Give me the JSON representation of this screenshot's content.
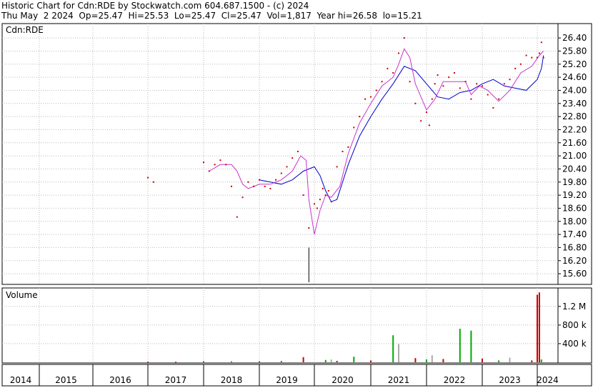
{
  "header": {
    "title_line": "Historic Chart for Cdn:RDE by Stockwatch.com 604.687.1500 - (c) 2024",
    "quote_line": "Thu May  2 2024  Op=25.47  Hi=25.53  Lo=25.47  Cl=25.47  Vol=1,817  Year hi=26.58  lo=15.21"
  },
  "chart_data": {
    "type": "line",
    "symbol_label": "Cdn:RDE",
    "volume_label": "Volume",
    "price_ticks": [
      "26.40",
      "25.80",
      "25.20",
      "24.60",
      "24.00",
      "23.40",
      "22.80",
      "22.20",
      "21.60",
      "21.00",
      "20.40",
      "19.80",
      "19.20",
      "18.60",
      "18.00",
      "17.40",
      "16.80",
      "16.20",
      "15.60"
    ],
    "volume_ticks": [
      "1.2 M",
      "800 k",
      "400 k"
    ],
    "years": [
      "2014",
      "2015",
      "2016",
      "2017",
      "2018",
      "2019",
      "2020",
      "2021",
      "2022",
      "2023",
      "2024"
    ],
    "ylim": [
      15.21,
      26.6
    ],
    "price_series": {
      "name": "close",
      "color": "#cc0000",
      "x": [
        2017.0,
        2017.1,
        2018.0,
        2018.1,
        2018.2,
        2018.3,
        2018.4,
        2018.5,
        2018.6,
        2018.7,
        2018.8,
        2018.9,
        2019.0,
        2019.1,
        2019.2,
        2019.3,
        2019.4,
        2019.5,
        2019.6,
        2019.7,
        2019.8,
        2019.9,
        2020.0,
        2020.05,
        2020.1,
        2020.15,
        2020.2,
        2020.25,
        2020.3,
        2020.4,
        2020.5,
        2020.6,
        2020.7,
        2020.8,
        2020.9,
        2021.0,
        2021.1,
        2021.2,
        2021.3,
        2021.4,
        2021.5,
        2021.6,
        2021.7,
        2021.8,
        2021.9,
        2022.0,
        2022.05,
        2022.1,
        2022.15,
        2022.2,
        2022.3,
        2022.4,
        2022.5,
        2022.6,
        2022.7,
        2022.8,
        2022.9,
        2023.0,
        2023.1,
        2023.2,
        2023.3,
        2023.4,
        2023.5,
        2023.6,
        2023.7,
        2023.8,
        2023.9,
        2024.0,
        2024.1,
        2024.2,
        2024.3
      ],
      "y": [
        20.0,
        19.8,
        20.7,
        20.3,
        20.6,
        20.8,
        20.6,
        19.6,
        18.2,
        19.1,
        19.8,
        19.6,
        19.9,
        19.6,
        19.5,
        19.9,
        20.2,
        20.5,
        20.9,
        21.2,
        19.2,
        17.7,
        18.8,
        18.6,
        19.0,
        19.5,
        19.2,
        19.4,
        18.9,
        20.5,
        21.2,
        21.4,
        22.3,
        22.8,
        23.6,
        23.7,
        24.0,
        24.4,
        25.0,
        24.8,
        25.7,
        26.4,
        24.4,
        23.4,
        22.6,
        23.0,
        22.4,
        23.6,
        24.3,
        24.7,
        24.2,
        24.6,
        24.8,
        24.1,
        24.4,
        23.6,
        24.3,
        24.2,
        23.8,
        23.2,
        23.6,
        24.3,
        24.5,
        25.0,
        25.2,
        25.6,
        25.5,
        25.5,
        25.7,
        26.2,
        25.5
      ],
      "line_marks": [
        {
          "x": 2019.9,
          "lo": 15.21,
          "hi": 16.8
        }
      ]
    },
    "ma_short": {
      "color": "#cc33cc",
      "x": [
        2018.1,
        2018.3,
        2018.5,
        2018.6,
        2018.7,
        2018.8,
        2019.0,
        2019.2,
        2019.4,
        2019.6,
        2019.75,
        2019.85,
        2019.9,
        2020.0,
        2020.1,
        2020.2,
        2020.3,
        2020.45,
        2020.6,
        2020.8,
        2021.0,
        2021.2,
        2021.4,
        2021.5,
        2021.6,
        2021.7,
        2021.8,
        2022.0,
        2022.15,
        2022.3,
        2022.5,
        2022.7,
        2022.8,
        2022.95,
        2023.1,
        2023.3,
        2023.5,
        2023.7,
        2023.9,
        2024.1,
        2024.3
      ],
      "y": [
        20.3,
        20.6,
        20.6,
        20.3,
        19.7,
        19.5,
        19.7,
        19.7,
        19.9,
        20.3,
        21.0,
        20.8,
        19.0,
        17.4,
        18.5,
        19.2,
        19.1,
        19.6,
        21.1,
        22.5,
        23.4,
        24.2,
        24.6,
        25.2,
        25.9,
        25.5,
        24.3,
        23.1,
        23.6,
        24.4,
        24.4,
        24.4,
        23.8,
        24.2,
        24.0,
        23.5,
        24.0,
        24.8,
        25.1,
        25.6,
        25.8
      ]
    },
    "ma_long": {
      "color": "#0000cc",
      "x": [
        2019.0,
        2019.2,
        2019.4,
        2019.6,
        2019.8,
        2020.0,
        2020.1,
        2020.2,
        2020.3,
        2020.4,
        2020.6,
        2020.8,
        2021.0,
        2021.2,
        2021.4,
        2021.6,
        2021.8,
        2022.0,
        2022.2,
        2022.4,
        2022.6,
        2022.8,
        2023.0,
        2023.2,
        2023.4,
        2023.6,
        2023.8,
        2024.0,
        2024.2,
        2024.3
      ],
      "y": [
        19.9,
        19.8,
        19.7,
        19.9,
        20.3,
        20.5,
        20.1,
        19.4,
        18.9,
        19.0,
        20.6,
        21.9,
        22.8,
        23.6,
        24.3,
        25.1,
        24.9,
        24.3,
        23.7,
        23.6,
        23.9,
        24.0,
        24.3,
        24.5,
        24.2,
        24.1,
        24.0,
        24.5,
        25.0,
        25.6
      ]
    },
    "volume_series": {
      "name": "volume",
      "x": [
        2017.0,
        2017.5,
        2018.0,
        2018.5,
        2019.0,
        2019.4,
        2019.8,
        2020.2,
        2020.3,
        2020.4,
        2020.7,
        2021.0,
        2021.4,
        2021.5,
        2021.8,
        2022.0,
        2022.1,
        2022.3,
        2022.6,
        2022.8,
        2023.0,
        2023.3,
        2023.5,
        2023.9,
        2024.0,
        2024.1,
        2024.2
      ],
      "values": [
        10000,
        10000,
        20000,
        20000,
        20000,
        30000,
        110000,
        50000,
        60000,
        30000,
        120000,
        40000,
        580000,
        390000,
        90000,
        60000,
        150000,
        70000,
        720000,
        680000,
        80000,
        40000,
        100000,
        40000,
        1450000,
        1500000,
        60000
      ],
      "colors": [
        "#cc0000",
        "#cc0000",
        "#cc0000",
        "#00aa00",
        "#cc0000",
        "#00aa00",
        "#cc0000",
        "#00aa00",
        "#aaaaaa",
        "#cc0000",
        "#00aa00",
        "#cc0000",
        "#00aa00",
        "#aaaaaa",
        "#cc0000",
        "#00aa00",
        "#aaaaaa",
        "#cc0000",
        "#00aa00",
        "#00aa00",
        "#cc0000",
        "#00aa00",
        "#aaaaaa",
        "#cc0000",
        "#cc0000",
        "#cc0000",
        "#00aa00"
      ],
      "ylim": [
        0,
        1550000
      ]
    }
  }
}
